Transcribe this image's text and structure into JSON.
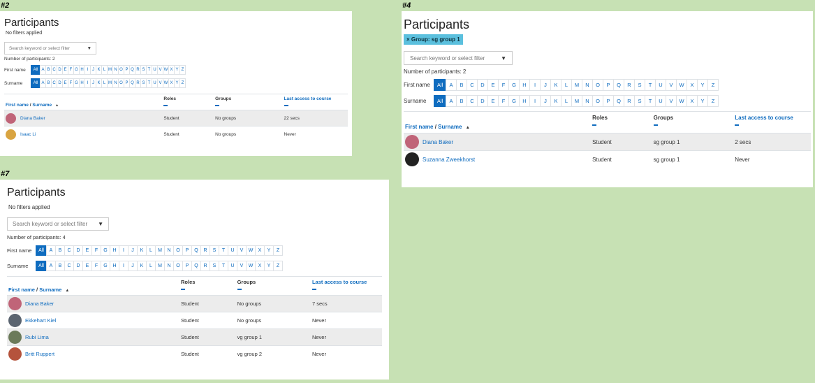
{
  "letters": [
    "A",
    "B",
    "C",
    "D",
    "E",
    "F",
    "G",
    "H",
    "I",
    "J",
    "K",
    "L",
    "M",
    "N",
    "O",
    "P",
    "Q",
    "R",
    "S",
    "T",
    "U",
    "V",
    "W",
    "X",
    "Y",
    "Z"
  ],
  "panels": {
    "p2": {
      "tag": "#2",
      "title": "Participants",
      "filter_text": "No filters applied",
      "search_placeholder": "Search keyword or select filter",
      "count": "Number of participants: 2",
      "firstname_label": "First name",
      "surname_label": "Surname",
      "all_label": "All",
      "headers": {
        "first_name": "First name",
        "surname": "Surname",
        "sep": "/",
        "sort": "▲",
        "roles": "Roles",
        "groups": "Groups",
        "last_access": "Last access to course"
      },
      "rows": [
        {
          "name": "Diana Baker",
          "role": "Student",
          "groups": "No groups",
          "last": "22 secs",
          "avatar": "#c06478"
        },
        {
          "name": "Isaac Li",
          "role": "Student",
          "groups": "No groups",
          "last": "Never",
          "avatar": "#d9a441"
        }
      ]
    },
    "p4": {
      "tag": "#4",
      "title": "Participants",
      "chip": "× Group: sg group 1",
      "search_placeholder": "Search keyword or select filter",
      "count": "Number of participants: 2",
      "firstname_label": "First name",
      "surname_label": "Surname",
      "all_label": "All",
      "headers": {
        "first_name": "First name",
        "surname": "Surname",
        "sep": "/",
        "sort": "▲",
        "roles": "Roles",
        "groups": "Groups",
        "last_access": "Last access to course"
      },
      "rows": [
        {
          "name": "Diana Baker",
          "role": "Student",
          "groups": "sg group 1",
          "last": "2 secs",
          "avatar": "#c06478"
        },
        {
          "name": "Suzanna Zweekhorst",
          "role": "Student",
          "groups": "sg group 1",
          "last": "Never",
          "avatar": "#222222"
        }
      ]
    },
    "p7": {
      "tag": "#7",
      "title": "Participants",
      "filter_text": "No filters applied",
      "search_placeholder": "Search keyword or select filter",
      "count": "Number of participants: 4",
      "firstname_label": "First name",
      "surname_label": "Surname",
      "all_label": "All",
      "headers": {
        "first_name": "First name",
        "surname": "Surname",
        "sep": "/",
        "sort": "▲",
        "roles": "Roles",
        "groups": "Groups",
        "last_access": "Last access to course"
      },
      "rows": [
        {
          "name": "Diana Baker",
          "role": "Student",
          "groups": "No groups",
          "last": "7 secs",
          "avatar": "#c06478"
        },
        {
          "name": "Ekkehart Kiel",
          "role": "Student",
          "groups": "No groups",
          "last": "Never",
          "avatar": "#5a6470"
        },
        {
          "name": "Rubi Lima",
          "role": "Student",
          "groups": "vg group 1",
          "last": "Never",
          "avatar": "#6b7a5a"
        },
        {
          "name": "Britt Ruppert",
          "role": "Student",
          "groups": "vg group 2",
          "last": "Never",
          "avatar": "#b5533c"
        }
      ]
    }
  },
  "colors": {
    "background": "#c7e1b4",
    "link": "#0f6cbf",
    "chip": "#5bc0de",
    "row_alt": "#ececec"
  },
  "icons": {
    "dropdown": "▼",
    "sort": "sort-ascending-icon"
  }
}
